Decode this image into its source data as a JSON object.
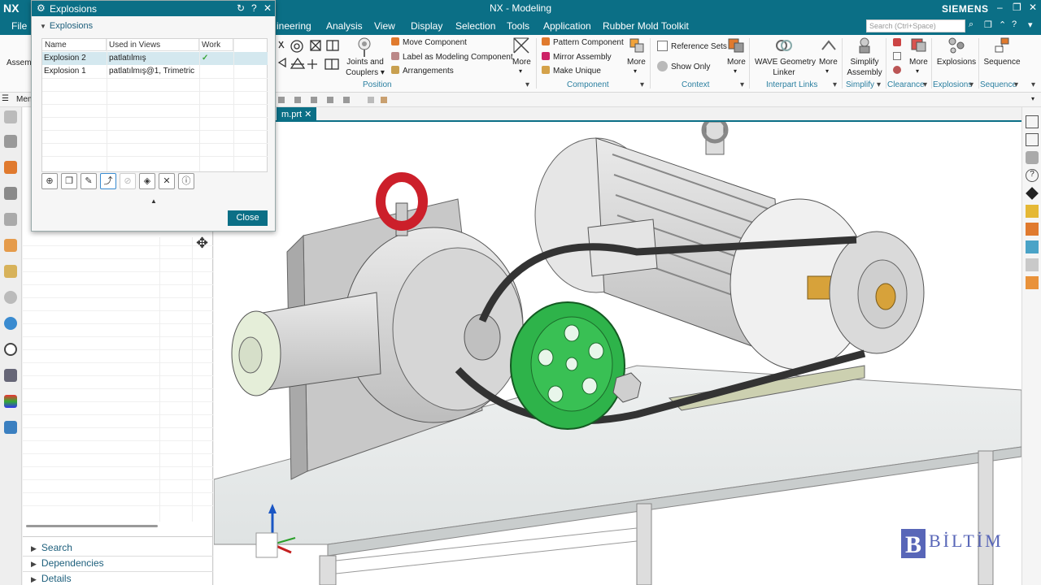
{
  "titlebar": {
    "logo": "NX",
    "title": "NX - Modeling",
    "brand": "SIEMENS"
  },
  "menu": {
    "file": "File",
    "items": [
      "ineering",
      "Analysis",
      "View",
      "Display",
      "Selection",
      "Tools",
      "Application",
      "Rubber Mold Toolkit"
    ],
    "search_placeholder": "Search (Ctrl+Space)"
  },
  "ribbon": {
    "assemble_label": "Assemb",
    "position": {
      "joints_label_1": "Joints and",
      "joints_label_2": "Couplers ▾",
      "move_component": "Move Component",
      "label_as_modeling": "Label as Modeling Component",
      "arrangements": "Arrangements",
      "group": "Position",
      "more": "More"
    },
    "component": {
      "pattern": "Pattern Component",
      "mirror": "Mirror Assembly",
      "make_unique": "Make Unique",
      "group": "Component",
      "more": "More"
    },
    "context": {
      "reference_sets": "Reference Sets",
      "show_only": "Show Only",
      "group": "Context",
      "more": "More"
    },
    "interpart": {
      "wave_1": "WAVE Geometry",
      "wave_2": "Linker",
      "group": "Interpart Links",
      "more": "More"
    },
    "simplify": {
      "simplify_1": "Simplify",
      "simplify_2": "Assembly",
      "group": "Simplify"
    },
    "clearance": {
      "group": "Clearance",
      "more": "More"
    },
    "explosions": {
      "label": "Explosions",
      "group": "Explosions"
    },
    "sequence": {
      "label": "Sequence",
      "group": "Sequence"
    }
  },
  "left_panel": {
    "menu_label": "Men",
    "sections": [
      "Search",
      "Dependencies",
      "Details"
    ]
  },
  "tab": {
    "label": "m.prt"
  },
  "dialog": {
    "title": "Explosions",
    "section": "Explosions",
    "columns": [
      "Name",
      "Used in Views",
      "Work"
    ],
    "rows": [
      {
        "name": "Explosion 2",
        "views": "patlatılmış",
        "work": "✓"
      },
      {
        "name": "Explosion 1",
        "views": "patlatılmış@1, Trimetric",
        "work": ""
      }
    ],
    "close_label": "Close"
  },
  "watermark": {
    "brand": "BİLTİM"
  },
  "colors": {
    "accent": "#0b6f86",
    "selection": "#d4e8ef",
    "group_label": "#2a7fa0"
  }
}
